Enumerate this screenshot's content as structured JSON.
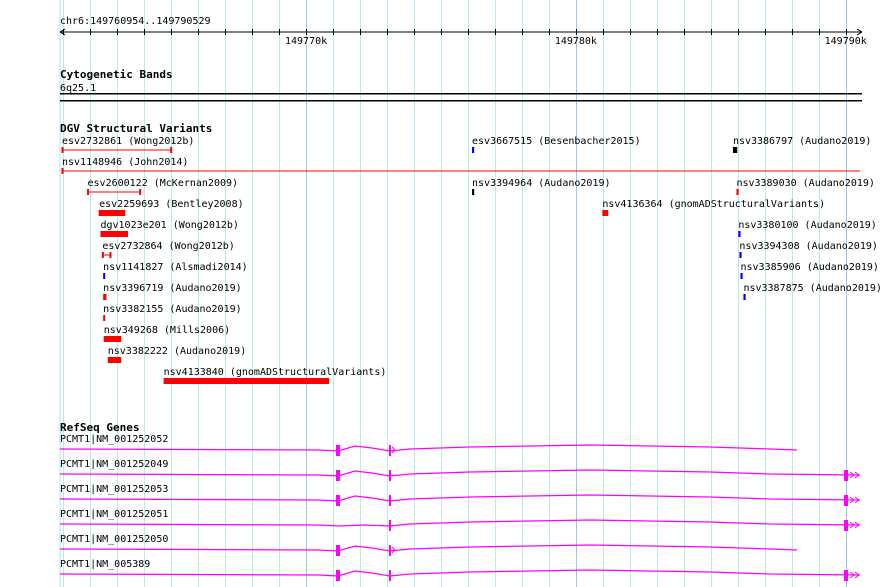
{
  "ruler": {
    "location": "chr6:149760954..149790529",
    "start": 149760954,
    "end": 149790529,
    "major_labels": [
      {
        "pos": 149770000,
        "label": "149770k"
      },
      {
        "pos": 149780000,
        "label": "149780k"
      },
      {
        "pos": 149790000,
        "label": "149790k"
      }
    ]
  },
  "cytobands": {
    "title": "Cytogenetic Bands",
    "band": "6q25.1"
  },
  "dgv": {
    "title": "DGV Structural Variants",
    "colors": {
      "red": "#ff0000",
      "blue": "#0000ff",
      "black": "#000000"
    },
    "features": [
      {
        "label": "esv2732861 (Wong2012b)",
        "start": 149760954,
        "end": 149765000,
        "color": "red",
        "style": "line",
        "row": 0
      },
      {
        "label": "nsv1148946 (John2014)",
        "start": 149760954,
        "end": 149790529,
        "color": "red",
        "style": "line",
        "row": 1
      },
      {
        "label": "esv2600122 (McKernan2009)",
        "start": 149761900,
        "end": 149763850,
        "color": "red",
        "style": "line",
        "row": 2
      },
      {
        "label": "esv2259693 (Bentley2008)",
        "start": 149762330,
        "end": 149763300,
        "color": "red",
        "style": "capbar",
        "row": 3
      },
      {
        "label": "dgv1023e201 (Wong2012b)",
        "start": 149762380,
        "end": 149763400,
        "color": "red",
        "style": "bar",
        "row": 4
      },
      {
        "label": "esv2732864 (Wong2012b)",
        "start": 149762450,
        "end": 149762750,
        "color": "red",
        "style": "line",
        "row": 5
      },
      {
        "label": "nsv1141827 (Alsmadi2014)",
        "start": 149762480,
        "end": 149762550,
        "color": "blue",
        "style": "bar",
        "row": 6
      },
      {
        "label": "nsv3396719 (Audano2019)",
        "start": 149762480,
        "end": 149762600,
        "color": "red",
        "style": "bar",
        "row": 7
      },
      {
        "label": "nsv3382155 (Audano2019)",
        "start": 149762480,
        "end": 149762540,
        "color": "red",
        "style": "bar",
        "row": 8
      },
      {
        "label": "nsv349268 (Mills2006)",
        "start": 149762500,
        "end": 149763150,
        "color": "red",
        "style": "bar",
        "row": 9
      },
      {
        "label": "nsv3382222 (Audano2019)",
        "start": 149762650,
        "end": 149763150,
        "color": "red",
        "style": "bar",
        "row": 10
      },
      {
        "label": "nsv4133840 (gnomADStructuralVariants)",
        "start": 149764720,
        "end": 149770850,
        "color": "red",
        "style": "bar",
        "row": 11
      },
      {
        "label": "esv3667515 (Besenbacher2015)",
        "start": 149776150,
        "end": 149776230,
        "color": "blue",
        "style": "bar",
        "row": 0
      },
      {
        "label": "nsv3386797 (Audano2019)",
        "start": 149785820,
        "end": 149785980,
        "color": "black",
        "style": "bar",
        "row": 0
      },
      {
        "label": "nsv3394964 (Audano2019)",
        "start": 149776150,
        "end": 149776230,
        "color": "black",
        "style": "bar",
        "row": 2
      },
      {
        "label": "nsv3389030 (Audano2019)",
        "start": 149785950,
        "end": 149786030,
        "color": "red",
        "style": "bar",
        "row": 2
      },
      {
        "label": "nsv4136364 (gnomADStructuralVariants)",
        "start": 149780980,
        "end": 149781200,
        "color": "red",
        "style": "bar",
        "row": 3
      },
      {
        "label": "nsv3380100 (Audano2019)",
        "start": 149786020,
        "end": 149786100,
        "color": "blue",
        "style": "bar",
        "row": 4
      },
      {
        "label": "nsv3394308 (Audano2019)",
        "start": 149786060,
        "end": 149786140,
        "color": "blue",
        "style": "bar",
        "row": 5
      },
      {
        "label": "nsv3385906 (Audano2019)",
        "start": 149786100,
        "end": 149786180,
        "color": "blue",
        "style": "bar",
        "row": 6
      },
      {
        "label": "nsv3387875 (Audano2019)",
        "start": 149786210,
        "end": 149786290,
        "color": "blue",
        "style": "bar",
        "row": 7
      }
    ]
  },
  "refseq": {
    "title": "RefSeq Genes",
    "color": "#ff00ff",
    "genes": [
      {
        "label": "PCMT1|NM_001252052",
        "exons": [
          149771200,
          149773150
        ],
        "last_exon": false,
        "end": 149788000
      },
      {
        "label": "PCMT1|NM_001252049",
        "exons": [
          149771200,
          149773150
        ],
        "last_exon": true,
        "end": 149790529
      },
      {
        "label": "PCMT1|NM_001252053",
        "exons": [
          149771200,
          149773150
        ],
        "last_exon": true,
        "end": 149790529
      },
      {
        "label": "PCMT1|NM_001252051",
        "exons": [
          149773150
        ],
        "last_exon": true,
        "end": 149790529
      },
      {
        "label": "PCMT1|NM_001252050",
        "exons": [
          149771200,
          149773150
        ],
        "last_exon": false,
        "end": 149788000
      },
      {
        "label": "PCMT1|NM_005389",
        "exons": [
          149771200,
          149773150
        ],
        "last_exon": true,
        "end": 149790529
      }
    ]
  }
}
